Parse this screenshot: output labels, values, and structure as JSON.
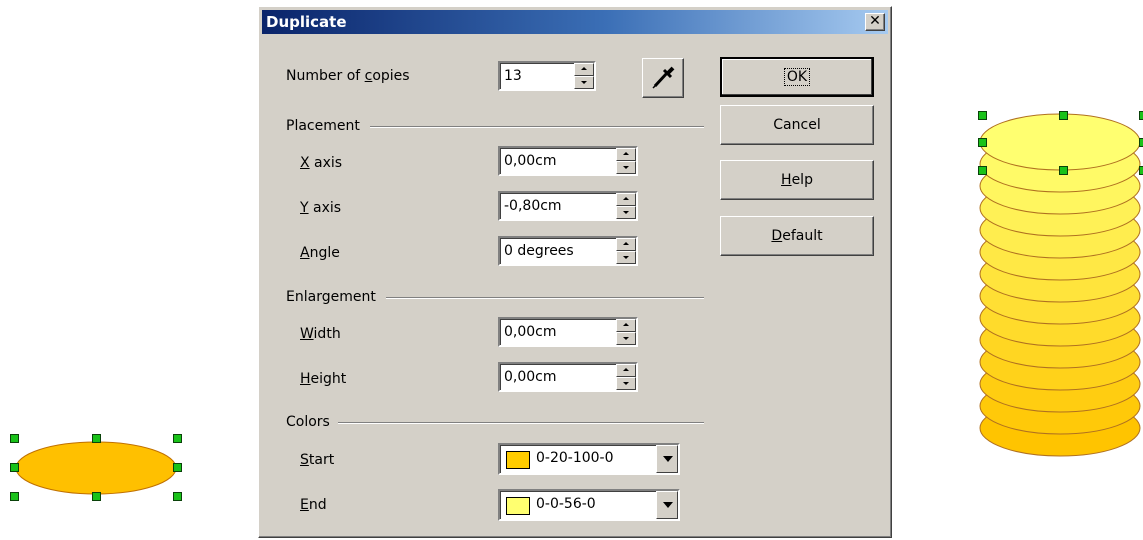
{
  "dialog": {
    "title": "Duplicate",
    "number_of_copies": {
      "label_pre": "Number of ",
      "label_mn": "c",
      "label_post": "opies",
      "value": "13"
    },
    "placement": {
      "heading": "Placement",
      "x_axis": {
        "mn": "X",
        "rest": " axis",
        "value": "0,00cm"
      },
      "y_axis": {
        "mn": "Y",
        "rest": " axis",
        "value": "-0,80cm"
      },
      "angle": {
        "mn": "A",
        "rest": "ngle",
        "value": "0 degrees"
      }
    },
    "enlargement": {
      "heading": "Enlargement",
      "width": {
        "mn": "W",
        "rest": "idth",
        "value": "0,00cm"
      },
      "height": {
        "mn": "H",
        "rest": "eight",
        "value": "0,00cm"
      }
    },
    "colors": {
      "heading": "Colors",
      "start": {
        "mn": "S",
        "rest": "tart",
        "value": "0-20-100-0",
        "swatch": "#ffcc00"
      },
      "end": {
        "mn": "E",
        "rest": "nd",
        "value": "0-0-56-0",
        "swatch": "#ffff70"
      }
    },
    "buttons": {
      "ok": "OK",
      "cancel": "Cancel",
      "help_mn": "H",
      "help_rest": "elp",
      "default_mn": "D",
      "default_rest": "efault"
    },
    "close_glyph": "✕"
  },
  "canvas": {
    "source_ellipse_color": "#ffc000",
    "stack_top_color": "#ffff70",
    "stack_bottom_color": "#ffc400",
    "stack_count": 14
  }
}
